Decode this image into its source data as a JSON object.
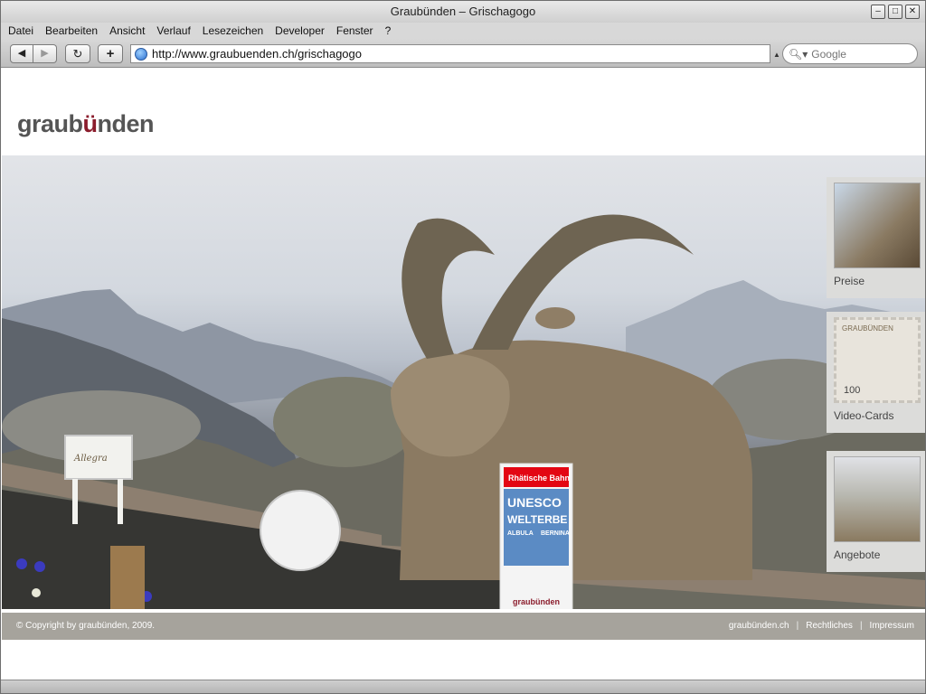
{
  "window": {
    "title": "Graubünden – Grischagogo"
  },
  "menu": [
    "Datei",
    "Bearbeiten",
    "Ansicht",
    "Verlauf",
    "Lesezeichen",
    "Developer",
    "Fenster",
    "?"
  ],
  "toolbar": {
    "url": "http://www.graubuenden.ch/grischagogo",
    "search_placeholder": "Google"
  },
  "page": {
    "logo": {
      "pre": "graub",
      "mid": "ü",
      "post": "nden"
    },
    "allegra_sign": "Allegra",
    "rhb": {
      "brand": "Rhätische Bahn",
      "line1": "UNESCO",
      "line2": "WELTERBE",
      "line3": "ALBULA",
      "line4": "BERNINA",
      "footer": "graubünden"
    },
    "stamp": {
      "country": "GRAUBÜNDEN",
      "value": "100"
    },
    "sidebar": [
      {
        "label": "Preise"
      },
      {
        "label": "Video-Cards"
      },
      {
        "label": "Angebote"
      }
    ],
    "footer": {
      "copyright": "© Copyright by graubünden, 2009.",
      "links": [
        "graubünden.ch",
        "Rechtliches",
        "Impressum"
      ]
    }
  },
  "colors": {
    "brand_red": "#8b1c2c",
    "rhb_red": "#e30613",
    "footer_bg": "#a6a39c"
  }
}
